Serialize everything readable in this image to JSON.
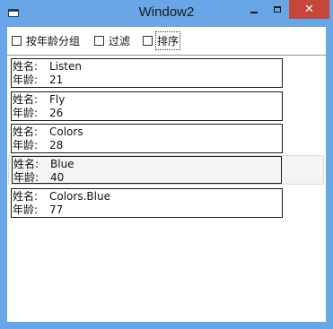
{
  "window": {
    "title": "Window2",
    "close_glyph": "✕"
  },
  "toolbar": {
    "group_by_age": {
      "label": "按年龄分组",
      "checked": false
    },
    "filter": {
      "label": "过滤",
      "checked": false
    },
    "sort": {
      "label": "排序",
      "checked": false
    }
  },
  "fields": {
    "name_label": "姓名:",
    "age_label": "年龄:"
  },
  "people": [
    {
      "name": "Listen",
      "age": "21"
    },
    {
      "name": "Fly",
      "age": "26"
    },
    {
      "name": "Colors",
      "age": "28"
    },
    {
      "name": "Blue",
      "age": "40"
    },
    {
      "name": "Colors.Blue",
      "age": "77"
    }
  ],
  "colors": {
    "frame": "#68a6e8",
    "close_button": "#c7463c"
  }
}
